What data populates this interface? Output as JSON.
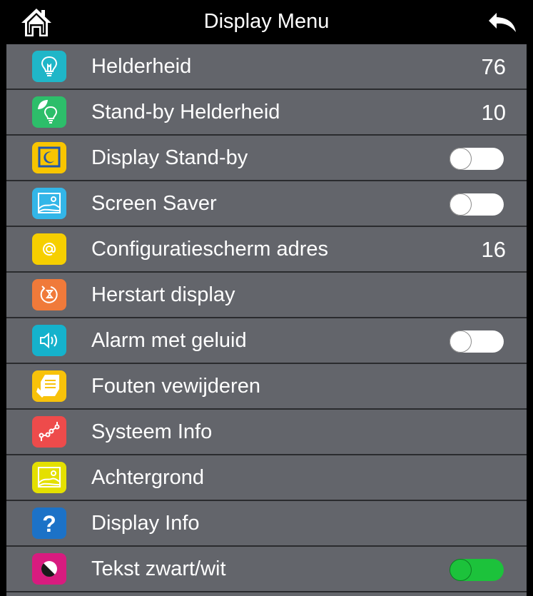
{
  "header": {
    "title": "Display Menu",
    "home_icon": "home-icon",
    "back_icon": "back-arrow-icon"
  },
  "colors": {
    "panel_bg": "#63656b",
    "toggle_on": "#1cc23b",
    "toggle_off": "#ffffff"
  },
  "items": [
    {
      "label": "Helderheid",
      "value": "76",
      "icon": "lightbulb-icon",
      "icon_color": "#1fb6c8"
    },
    {
      "label": "Stand-by Helderheid",
      "value": "10",
      "icon": "eco-bulb-icon",
      "icon_color": "#2dbe6a"
    },
    {
      "label": "Display Stand-by",
      "toggle": "off",
      "icon": "moon-screen-icon",
      "icon_color": "#f8c500"
    },
    {
      "label": "Screen Saver",
      "toggle": "off",
      "icon": "landscape-picture-icon",
      "icon_color": "#33b6e8"
    },
    {
      "label": "Configuratiescherm adres",
      "value": "16",
      "icon": "at-sign-icon",
      "icon_color": "#f6cf00"
    },
    {
      "label": "Herstart display",
      "icon": "restart-icon",
      "icon_color": "#f07a3a"
    },
    {
      "label": "Alarm met geluid",
      "toggle": "off",
      "icon": "speaker-icon",
      "icon_color": "#15b2cc"
    },
    {
      "label": "Fouten vewijderen",
      "icon": "erase-document-icon",
      "icon_color": "#f8c20a"
    },
    {
      "label": "Systeem Info",
      "icon": "network-nodes-icon",
      "icon_color": "#ee4b4b"
    },
    {
      "label": "Achtergrond",
      "icon": "background-picture-icon",
      "icon_color": "#e4e000"
    },
    {
      "label": "Display Info",
      "icon": "question-mark-icon",
      "icon_color": "#1c72c7"
    },
    {
      "label": "Tekst zwart/wit",
      "toggle": "on",
      "icon": "contrast-icon",
      "icon_color": "#d81b7f"
    }
  ]
}
